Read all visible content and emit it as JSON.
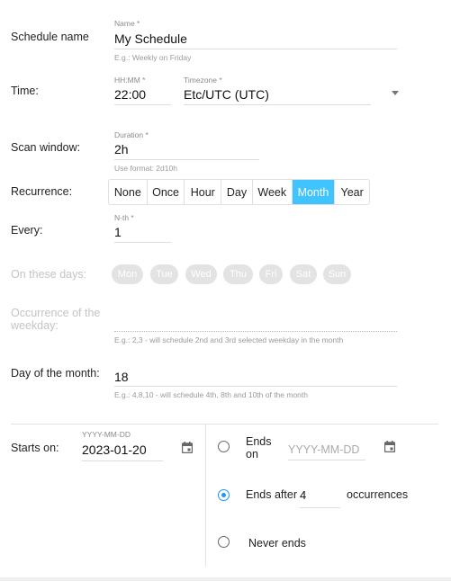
{
  "schedule_name": {
    "label": "Schedule name",
    "field_label": "Name *",
    "value": "My Schedule",
    "hint": "E.g.: Weekly on Friday"
  },
  "time": {
    "label": "Time:",
    "time_label": "HH:MM *",
    "time_value": "22:00",
    "tz_label": "Timezone *",
    "tz_value": "Etc/UTC (UTC)"
  },
  "scan_window": {
    "label": "Scan window:",
    "field_label": "Duration *",
    "value": "2h",
    "hint": "Use format: 2d10h"
  },
  "recurrence": {
    "label": "Recurrence:",
    "options": [
      "None",
      "Once",
      "Hour",
      "Day",
      "Week",
      "Month",
      "Year"
    ],
    "selected": "Month",
    "accent": "#40c4ff"
  },
  "every": {
    "label": "Every:",
    "field_label": "N-th *",
    "value": "1"
  },
  "days": {
    "label": "On these days:",
    "options": [
      "Mon",
      "Tue",
      "Wed",
      "Thu",
      "Fri",
      "Sat",
      "Sun"
    ]
  },
  "occurrence": {
    "label_line1": "Occurrence of the",
    "label_line2": "weekday:",
    "value": "",
    "hint": "E.g.: 2,3 - will schedule 2nd and 3rd selected weekday in the month"
  },
  "day_of_month": {
    "label": "Day of the month:",
    "value": "18",
    "hint": "E.g.: 4,8,10 - will schedule 4th, 8th and 10th of the month"
  },
  "starts": {
    "label": "Starts on:",
    "field_label": "YYYY-MM-DD",
    "value": "2023-01-20"
  },
  "ends": {
    "on_line1": "Ends",
    "on_line2": "on",
    "on_placeholder": "YYYY-MM-DD",
    "after_label": "Ends after",
    "after_value": "4",
    "after_suffix": "occurrences",
    "never_label": "Never ends",
    "selected": "after"
  }
}
